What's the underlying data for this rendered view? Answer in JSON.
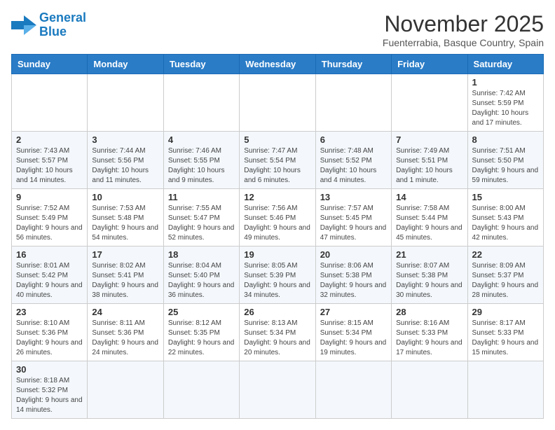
{
  "logo": {
    "line1": "General",
    "line2": "Blue"
  },
  "title": "November 2025",
  "subtitle": "Fuenterrabia, Basque Country, Spain",
  "weekdays": [
    "Sunday",
    "Monday",
    "Tuesday",
    "Wednesday",
    "Thursday",
    "Friday",
    "Saturday"
  ],
  "weeks": [
    [
      {
        "day": "",
        "info": ""
      },
      {
        "day": "",
        "info": ""
      },
      {
        "day": "",
        "info": ""
      },
      {
        "day": "",
        "info": ""
      },
      {
        "day": "",
        "info": ""
      },
      {
        "day": "",
        "info": ""
      },
      {
        "day": "1",
        "info": "Sunrise: 7:42 AM\nSunset: 5:59 PM\nDaylight: 10 hours and 17 minutes."
      }
    ],
    [
      {
        "day": "2",
        "info": "Sunrise: 7:43 AM\nSunset: 5:57 PM\nDaylight: 10 hours and 14 minutes."
      },
      {
        "day": "3",
        "info": "Sunrise: 7:44 AM\nSunset: 5:56 PM\nDaylight: 10 hours and 11 minutes."
      },
      {
        "day": "4",
        "info": "Sunrise: 7:46 AM\nSunset: 5:55 PM\nDaylight: 10 hours and 9 minutes."
      },
      {
        "day": "5",
        "info": "Sunrise: 7:47 AM\nSunset: 5:54 PM\nDaylight: 10 hours and 6 minutes."
      },
      {
        "day": "6",
        "info": "Sunrise: 7:48 AM\nSunset: 5:52 PM\nDaylight: 10 hours and 4 minutes."
      },
      {
        "day": "7",
        "info": "Sunrise: 7:49 AM\nSunset: 5:51 PM\nDaylight: 10 hours and 1 minute."
      },
      {
        "day": "8",
        "info": "Sunrise: 7:51 AM\nSunset: 5:50 PM\nDaylight: 9 hours and 59 minutes."
      }
    ],
    [
      {
        "day": "9",
        "info": "Sunrise: 7:52 AM\nSunset: 5:49 PM\nDaylight: 9 hours and 56 minutes."
      },
      {
        "day": "10",
        "info": "Sunrise: 7:53 AM\nSunset: 5:48 PM\nDaylight: 9 hours and 54 minutes."
      },
      {
        "day": "11",
        "info": "Sunrise: 7:55 AM\nSunset: 5:47 PM\nDaylight: 9 hours and 52 minutes."
      },
      {
        "day": "12",
        "info": "Sunrise: 7:56 AM\nSunset: 5:46 PM\nDaylight: 9 hours and 49 minutes."
      },
      {
        "day": "13",
        "info": "Sunrise: 7:57 AM\nSunset: 5:45 PM\nDaylight: 9 hours and 47 minutes."
      },
      {
        "day": "14",
        "info": "Sunrise: 7:58 AM\nSunset: 5:44 PM\nDaylight: 9 hours and 45 minutes."
      },
      {
        "day": "15",
        "info": "Sunrise: 8:00 AM\nSunset: 5:43 PM\nDaylight: 9 hours and 42 minutes."
      }
    ],
    [
      {
        "day": "16",
        "info": "Sunrise: 8:01 AM\nSunset: 5:42 PM\nDaylight: 9 hours and 40 minutes."
      },
      {
        "day": "17",
        "info": "Sunrise: 8:02 AM\nSunset: 5:41 PM\nDaylight: 9 hours and 38 minutes."
      },
      {
        "day": "18",
        "info": "Sunrise: 8:04 AM\nSunset: 5:40 PM\nDaylight: 9 hours and 36 minutes."
      },
      {
        "day": "19",
        "info": "Sunrise: 8:05 AM\nSunset: 5:39 PM\nDaylight: 9 hours and 34 minutes."
      },
      {
        "day": "20",
        "info": "Sunrise: 8:06 AM\nSunset: 5:38 PM\nDaylight: 9 hours and 32 minutes."
      },
      {
        "day": "21",
        "info": "Sunrise: 8:07 AM\nSunset: 5:38 PM\nDaylight: 9 hours and 30 minutes."
      },
      {
        "day": "22",
        "info": "Sunrise: 8:09 AM\nSunset: 5:37 PM\nDaylight: 9 hours and 28 minutes."
      }
    ],
    [
      {
        "day": "23",
        "info": "Sunrise: 8:10 AM\nSunset: 5:36 PM\nDaylight: 9 hours and 26 minutes."
      },
      {
        "day": "24",
        "info": "Sunrise: 8:11 AM\nSunset: 5:36 PM\nDaylight: 9 hours and 24 minutes."
      },
      {
        "day": "25",
        "info": "Sunrise: 8:12 AM\nSunset: 5:35 PM\nDaylight: 9 hours and 22 minutes."
      },
      {
        "day": "26",
        "info": "Sunrise: 8:13 AM\nSunset: 5:34 PM\nDaylight: 9 hours and 20 minutes."
      },
      {
        "day": "27",
        "info": "Sunrise: 8:15 AM\nSunset: 5:34 PM\nDaylight: 9 hours and 19 minutes."
      },
      {
        "day": "28",
        "info": "Sunrise: 8:16 AM\nSunset: 5:33 PM\nDaylight: 9 hours and 17 minutes."
      },
      {
        "day": "29",
        "info": "Sunrise: 8:17 AM\nSunset: 5:33 PM\nDaylight: 9 hours and 15 minutes."
      }
    ],
    [
      {
        "day": "30",
        "info": "Sunrise: 8:18 AM\nSunset: 5:32 PM\nDaylight: 9 hours and 14 minutes."
      },
      {
        "day": "",
        "info": ""
      },
      {
        "day": "",
        "info": ""
      },
      {
        "day": "",
        "info": ""
      },
      {
        "day": "",
        "info": ""
      },
      {
        "day": "",
        "info": ""
      },
      {
        "day": "",
        "info": ""
      }
    ]
  ]
}
